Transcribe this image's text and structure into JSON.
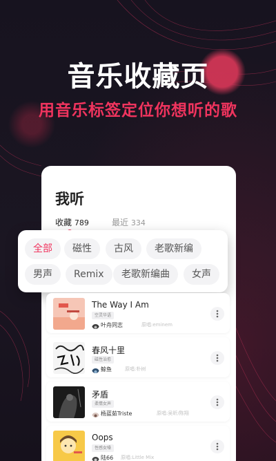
{
  "hero": {
    "title": "音乐收藏页",
    "subtitle": "用音乐标签定位你想听的歌"
  },
  "card": {
    "title": "我听",
    "tabs": [
      {
        "label": "收藏",
        "count": "789",
        "active": true
      },
      {
        "label": "最近",
        "count": "334",
        "active": false
      }
    ]
  },
  "tags": [
    {
      "label": "全部",
      "active": true
    },
    {
      "label": "磁性",
      "active": false
    },
    {
      "label": "古风",
      "active": false
    },
    {
      "label": "老歌新编",
      "active": false
    },
    {
      "label": "男声",
      "active": false
    },
    {
      "label": "Remix",
      "active": false
    },
    {
      "label": "老歌新编曲",
      "active": false
    },
    {
      "label": "女声",
      "active": false
    }
  ],
  "songs": [
    {
      "title": "The Way I Am",
      "tag": "空灵华语",
      "user": "叶舟同志",
      "source": "原唱:eminem"
    },
    {
      "title": "春风十里",
      "tag": "磁性治愈",
      "user": "鲸鱼",
      "source": "原唱:朴树"
    },
    {
      "title": "矛盾",
      "tag": "柔情女声",
      "user": "杨蓝茹Triste",
      "source": "原唱:吴昕/陈翔"
    },
    {
      "title": "Oops",
      "tag": "性感女嗓",
      "user": "陆66",
      "source": "原唱:Little Mix"
    }
  ],
  "colors": {
    "accent": "#f0345e",
    "background": "#14111c",
    "card": "#ffffff"
  },
  "icons": [
    "more-vertical-icon"
  ]
}
